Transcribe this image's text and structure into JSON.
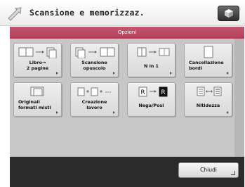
{
  "window": {
    "title": "Scansione e memorizzaz.",
    "title_icon": "scan-arrow-icon",
    "status_icon": "cube-icon"
  },
  "panel": {
    "header": "Opzioni"
  },
  "options": [
    {
      "label_line1": "Libro→",
      "label_line2": "2 pagine",
      "icon": "book-to-two-pages-icon"
    },
    {
      "label_line1": "Scansione",
      "label_line2": "opuscolo",
      "icon": "booklet-scan-icon"
    },
    {
      "label_line1": "N in 1",
      "label_line2": "",
      "icon": "n-in-1-icon"
    },
    {
      "label_line1": "Cancellazione",
      "label_line2": "bordi",
      "icon": "erase-borders-icon"
    },
    {
      "label_line1": "Originali",
      "label_line2": "formati misti",
      "icon": "mixed-originals-icon"
    },
    {
      "label_line1": "Creazione",
      "label_line2": "lavoro",
      "icon": "job-build-icon"
    },
    {
      "label_line1": "Nega/Posi",
      "label_line2": "",
      "icon": "nega-posi-icon"
    },
    {
      "label_line1": "Nitidezza",
      "label_line2": "",
      "icon": "sharpness-icon"
    }
  ],
  "nega_posi": {
    "left": "R",
    "right": "R"
  },
  "footer": {
    "close_label": "Chiudi"
  },
  "colors": {
    "header_bg": "#b8465f",
    "panel_bg": "#c7c7c7",
    "footer_bg": "#2b2b2b"
  }
}
